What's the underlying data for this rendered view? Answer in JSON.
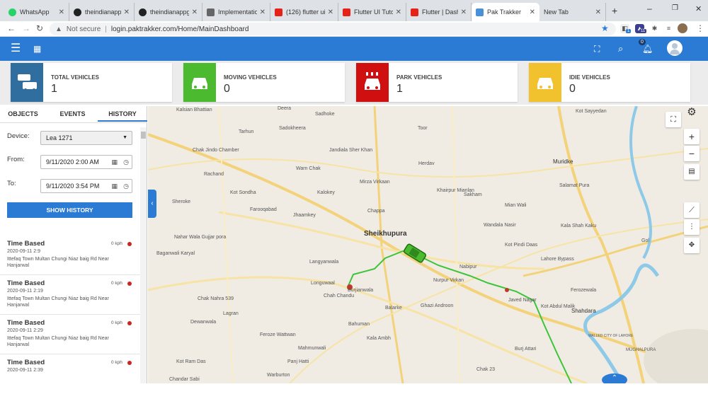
{
  "browser": {
    "tabs": [
      {
        "title": "WhatsApp",
        "color": "#25d366"
      },
      {
        "title": "theindianappgu",
        "color": "#222222"
      },
      {
        "title": "theindianappgu",
        "color": "#222222"
      },
      {
        "title": "Implementation",
        "color": "#555555"
      },
      {
        "title": "(126) flutter ui",
        "color": "#e62117"
      },
      {
        "title": "Flutter UI Tutor",
        "color": "#e62117"
      },
      {
        "title": "Flutter | Dashbo",
        "color": "#e62117"
      },
      {
        "title": "Pak Trakker",
        "color": "#4a90d9"
      },
      {
        "title": "New Tab",
        "color": "#dee1e6"
      }
    ],
    "not_secure": "Not secure",
    "url": "login.paktrakker.com/Home/MainDashboard",
    "ext_badge_1": "1",
    "ext_badge_2": "11"
  },
  "header": {
    "notification_count": "0"
  },
  "stats": [
    {
      "label": "TOTAL VEHICLES",
      "value": "1",
      "color": "#2f6e9e"
    },
    {
      "label": "MOVING VEHICLES",
      "value": "0",
      "color": "#4cba2e"
    },
    {
      "label": "PARK VEHICLES",
      "value": "1",
      "color": "#d01010"
    },
    {
      "label": "IDIE VEHICLES",
      "value": "0",
      "color": "#f2c22e"
    }
  ],
  "panel": {
    "tabs": [
      "OBJECTS",
      "EVENTS",
      "HISTORY"
    ],
    "device_label": "Device:",
    "device_value": "Lea 1271",
    "from_label": "From:",
    "from_value": "9/11/2020 2:00 AM",
    "to_label": "To:",
    "to_value": "9/11/2020 3:54 PM",
    "show_history": "SHOW HISTORY",
    "history": [
      {
        "title": "Time Based",
        "speed": "0 kph",
        "time": "2020-09-11 2:9",
        "address": "Ittefaq Town Multan Chungi Niaz baig Rd Near Hanjarwal"
      },
      {
        "title": "Time Based",
        "speed": "0 kph",
        "time": "2020-09-11 2:19",
        "address": "Ittefaq Town Multan Chungi Niaz baig Rd Near Hanjarwal"
      },
      {
        "title": "Time Based",
        "speed": "0 kph",
        "time": "2020-09-11 2:29",
        "address": "Ittefaq Town Multan Chungi Niaz baig Rd Near Hanjarwal"
      },
      {
        "title": "Time Based",
        "speed": "0 kph",
        "time": "2020-09-11 2:39",
        "address": ""
      }
    ]
  },
  "map": {
    "labels": {
      "sheikhupura": "Sheikhupura",
      "muridke": "Muridke",
      "shahdara": "Shahdara",
      "kala_shah_kaku": "Kala Shah Kaku",
      "faroqabad": "Farooqabad",
      "deera": "Deera",
      "sadhoke": "Sadhoke",
      "kot_sayyedan": "Kot Sayyedan",
      "kalsian_bhattian": "Kalsian Bhattian",
      "tarhun": "Tarhun",
      "sadokheera": "Sadokheera",
      "toor": "Toor",
      "chak_jindo": "Chak Jindo Chamber",
      "jandiala": "Jandiala Sher Khan",
      "warn_chak": "Warn Chak",
      "rachand": "Rachand",
      "mirza_virkaan": "Mirza Virkaan",
      "herdav": "Herdav",
      "kot_sondha": "Kot Sondha",
      "kalokey": "Kalokey",
      "khairpur": "Khairpur Mianlan",
      "sakham": "Sakham",
      "salamat_pura": "Salamat Pura",
      "sheroke": "Sheroke",
      "jhaamkey": "Jhaamkey",
      "chappa": "Chappa",
      "mian_wali": "Mian Wali",
      "wandala_nasir": "Wandala Nasir",
      "kot_pindi_daas": "Kot Pindi Daas",
      "nahar_wala": "Nahar Wala Gujjar pora",
      "baganwali": "Baganwali Karyal",
      "langyanwala": "Langyanwala",
      "nabipur": "Nabipur",
      "nurpur_virkan": "Nurpur Virkan",
      "longuwaal": "Longuwaal",
      "burjianwala": "Burjianwala",
      "chah_chandu": "Chah Chandu",
      "javed_nagar": "Javed Nagar",
      "kot_abdul_malik": "Kot Abdul Malik",
      "ferozewala": "Ferozewala",
      "chak_nahra": "Chak Nahra 539",
      "balarke": "Balarke",
      "ghazi_androon": "Ghazi Androon",
      "lagran": "Lagran",
      "dewanwala": "Dewanwala",
      "bahuman": "Bahuman",
      "feroze_wattwan": "Feroze Wattwan",
      "kala_ambh": "Kala Ambh",
      "mahmunwali": "Mahmunwali",
      "burj_attari": "Burj Attari",
      "kot_ram_das": "Kot Ram Das",
      "chak_23": "Chak 23",
      "panj_hatti": "Panj Hatti",
      "warburton": "Warburton",
      "chandar_sabi": "Chandar Sabi",
      "walled_city": "WALLED CITY OF LAHORE",
      "mughalpura": "MUGHALPURA",
      "gol": "Gol",
      "lahore_bypass": "Lahore Bypass"
    }
  }
}
